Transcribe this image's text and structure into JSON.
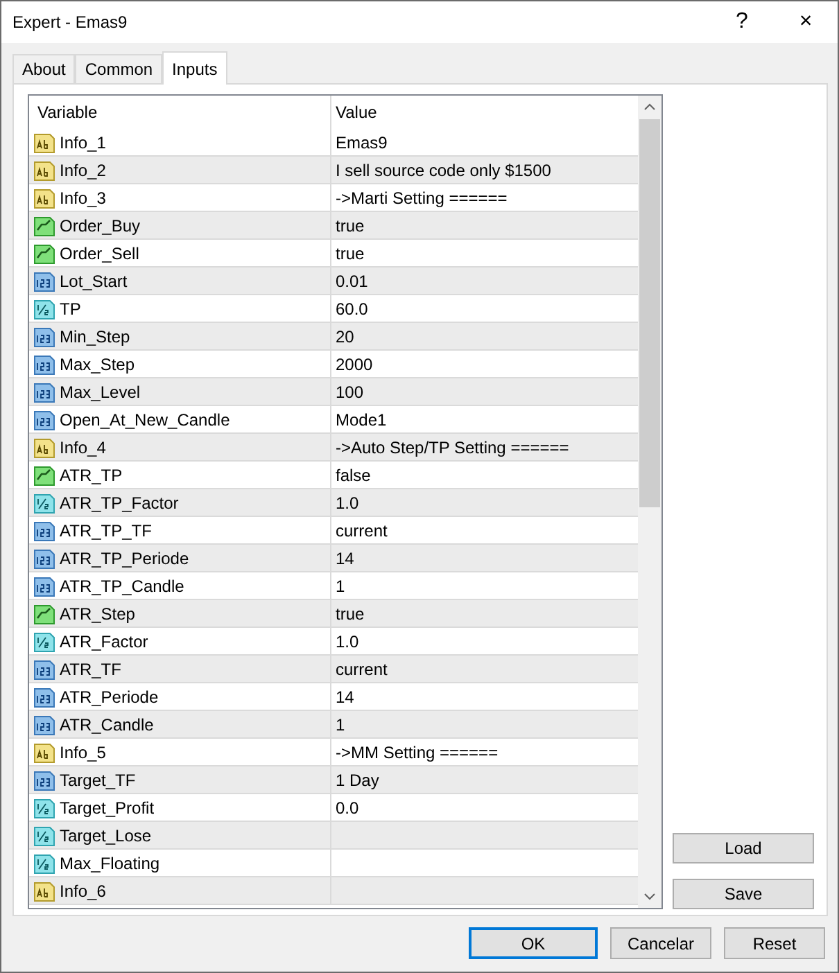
{
  "window": {
    "title": "Expert - Emas9",
    "help": "?",
    "close": "×"
  },
  "tabs": [
    {
      "label": "About",
      "selected": false
    },
    {
      "label": "Common",
      "selected": false
    },
    {
      "label": "Inputs",
      "selected": true
    }
  ],
  "table": {
    "columns": [
      "Variable",
      "Value"
    ],
    "rows": [
      {
        "kind": "string",
        "variable": "Info_1",
        "value": "Emas9"
      },
      {
        "kind": "string",
        "variable": "Info_2",
        "value": "I sell source code only $1500"
      },
      {
        "kind": "string",
        "variable": "Info_3",
        "value": "->Marti Setting ======"
      },
      {
        "kind": "bool",
        "variable": "Order_Buy",
        "value": "true"
      },
      {
        "kind": "bool",
        "variable": "Order_Sell",
        "value": "true"
      },
      {
        "kind": "int",
        "variable": "Lot_Start",
        "value": "0.01"
      },
      {
        "kind": "double",
        "variable": "TP",
        "value": "60.0"
      },
      {
        "kind": "int",
        "variable": "Min_Step",
        "value": "20"
      },
      {
        "kind": "int",
        "variable": "Max_Step",
        "value": "2000"
      },
      {
        "kind": "int",
        "variable": "Max_Level",
        "value": "100"
      },
      {
        "kind": "int",
        "variable": "Open_At_New_Candle",
        "value": "Mode1"
      },
      {
        "kind": "string",
        "variable": "Info_4",
        "value": "->Auto Step/TP Setting ======"
      },
      {
        "kind": "bool",
        "variable": "ATR_TP",
        "value": "false"
      },
      {
        "kind": "double",
        "variable": "ATR_TP_Factor",
        "value": "1.0"
      },
      {
        "kind": "int",
        "variable": "ATR_TP_TF",
        "value": "current"
      },
      {
        "kind": "int",
        "variable": "ATR_TP_Periode",
        "value": "14"
      },
      {
        "kind": "int",
        "variable": "ATR_TP_Candle",
        "value": "1"
      },
      {
        "kind": "bool",
        "variable": "ATR_Step",
        "value": "true"
      },
      {
        "kind": "double",
        "variable": "ATR_Factor",
        "value": "1.0"
      },
      {
        "kind": "int",
        "variable": "ATR_TF",
        "value": "current"
      },
      {
        "kind": "int",
        "variable": "ATR_Periode",
        "value": "14"
      },
      {
        "kind": "int",
        "variable": "ATR_Candle",
        "value": "1"
      },
      {
        "kind": "string",
        "variable": "Info_5",
        "value": "->MM Setting ======"
      },
      {
        "kind": "int",
        "variable": "Target_TF",
        "value": "1 Day"
      },
      {
        "kind": "double",
        "variable": "Target_Profit",
        "value": "0.0"
      },
      {
        "kind": "double",
        "variable": "Target_Lose"
      },
      {
        "kind": "double",
        "variable": "Max_Floating"
      },
      {
        "kind": "string",
        "variable": "Info_6"
      }
    ]
  },
  "side_buttons": [
    "Load",
    "Save"
  ],
  "buttons": [
    {
      "label": "OK",
      "focused": true
    },
    {
      "label": "Cancelar",
      "focused": false
    },
    {
      "label": "Reset",
      "focused": false
    }
  ]
}
